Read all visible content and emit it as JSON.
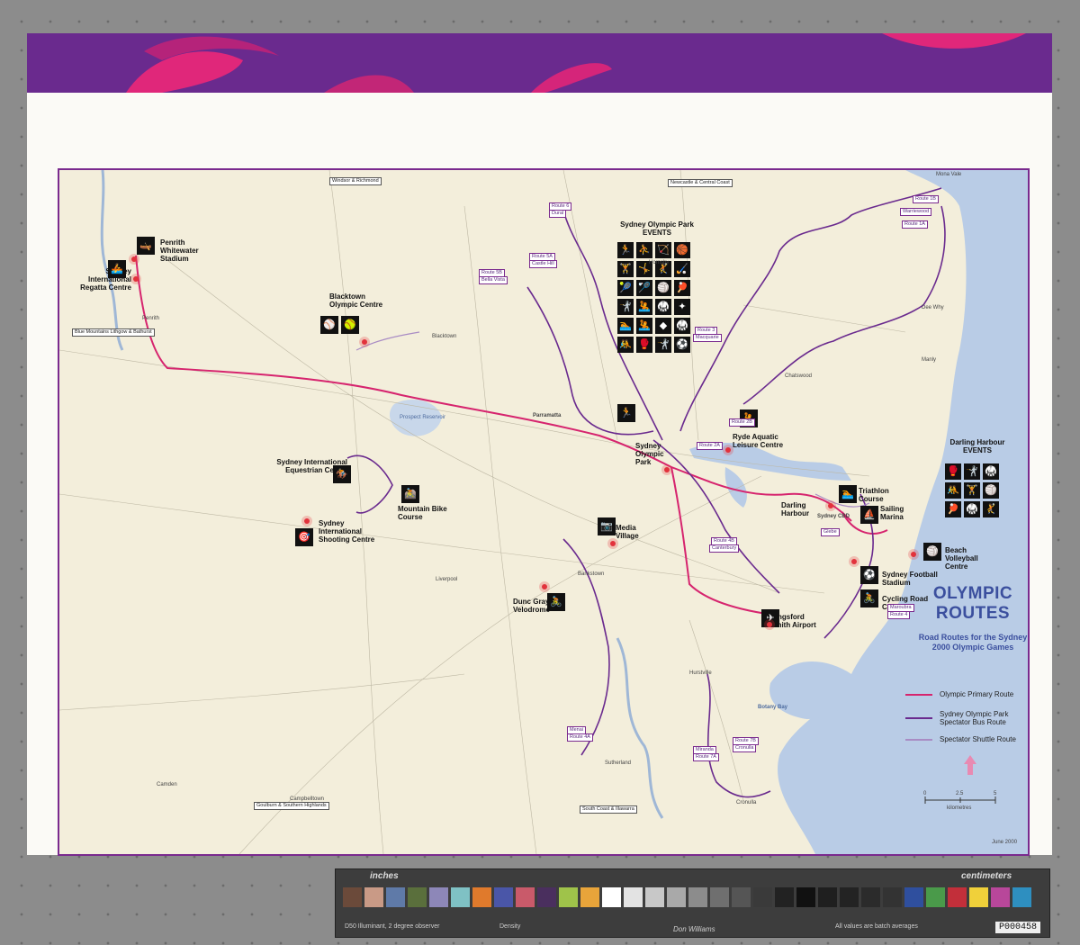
{
  "map": {
    "title_line1": "OLYMPIC",
    "title_line2": "ROUTES",
    "subtitle": "Road Routes for the Sydney 2000 Olympic Games",
    "date": "June 2000",
    "scale": {
      "ticks": [
        "0",
        "2.5",
        "5"
      ],
      "unit": "kilometres"
    },
    "legend": [
      {
        "label": "Olympic Primary Route",
        "color": "#d6246e"
      },
      {
        "label": "Sydney Olympic Park Spectator Bus Route",
        "color": "#6a2a8e"
      },
      {
        "label": "Spectator Shuttle Route",
        "color": "#a98cc4"
      }
    ],
    "sections": {
      "olympic_park_events": "Sydney Olympic Park EVENTS",
      "darling_harbour_events": "Darling Harbour EVENTS"
    },
    "venues": [
      "Penrith Whitewater Stadium",
      "Sydney International Regatta Centre",
      "Blacktown Olympic Centre",
      "Sydney International Equestrian Centre",
      "Mountain Bike Course",
      "Sydney International Shooting Centre",
      "Dunc Gray Velodrome",
      "Media Village",
      "Sydney Olympic Park",
      "Ryde Aquatic Leisure Centre",
      "Darling Harbour",
      "Triathlon Course",
      "Sailing Marina",
      "Beach Volleyball Centre",
      "Sydney Football Stadium",
      "Cycling Road Course",
      "Kingsford Smith Airport"
    ],
    "places": [
      "Penrith",
      "Parramatta",
      "Blacktown",
      "Liverpool",
      "Bankstown",
      "Campbelltown",
      "Camden",
      "Hornsby",
      "Chatswood",
      "Manly",
      "Hurstville",
      "Sutherland",
      "Cronulla",
      "Botany Bay",
      "Sydney CBD",
      "Mona Vale",
      "Dee Why",
      "Prospect Reservoir"
    ],
    "routes": [
      "Route 1A",
      "Route 1B",
      "Route 2A",
      "Route 2B",
      "Route 3",
      "Route 4",
      "Route 4A",
      "Route 4B",
      "Route 5A",
      "Route 5B",
      "Route 6",
      "Route 7A",
      "Route 7B"
    ],
    "route_stops": [
      "Warriewood",
      "Macquarie",
      "Castle Hill",
      "Bella Vista",
      "Dural",
      "Canterbury",
      "Menai",
      "Miranda",
      "Cronulla",
      "Maroubra",
      "Glebe"
    ],
    "direction_boxes": [
      "Windsor & Richmond",
      "Newcastle & Central Coast",
      "Blue Mountains Lithgow & Bathurst",
      "Goulburn & Southern Highlands",
      "South Coast & Illawarra"
    ]
  },
  "target": {
    "label_inches": "inches",
    "label_cm": "centimeters",
    "illuminant": "D50 Illuminant, 2 degree observer",
    "density": "Density",
    "note": "All values are batch averages",
    "brand": "Don Williams",
    "id": "P000458",
    "patches": [
      "#6b4a3a",
      "#c99a86",
      "#5f7aa8",
      "#5a6f3c",
      "#8d87b8",
      "#7fc1c4",
      "#e07a2c",
      "#4a56a8",
      "#c95a6a",
      "#4a2f5e",
      "#9fc34a",
      "#e8a43a",
      "#ffffff",
      "#e3e3e3",
      "#c8c8c8",
      "#a9a9a9",
      "#8c8c8c",
      "#6f6f6f",
      "#555555",
      "#3a3a3a",
      "#222222",
      "#111111",
      "#1f1f1f",
      "#232323",
      "#2b2b2b",
      "#333333",
      "#2f4f9e",
      "#4a9a4a",
      "#c22f3a",
      "#f0d03a",
      "#b8479a",
      "#2e8fc0"
    ]
  },
  "colors": {
    "banner": "#6a2a8e",
    "banner_accent": "#e0277a",
    "water": "#b9cce6",
    "primary_route": "#d6246e",
    "bus_route": "#6a2a8e",
    "title": "#3b4f9e"
  }
}
